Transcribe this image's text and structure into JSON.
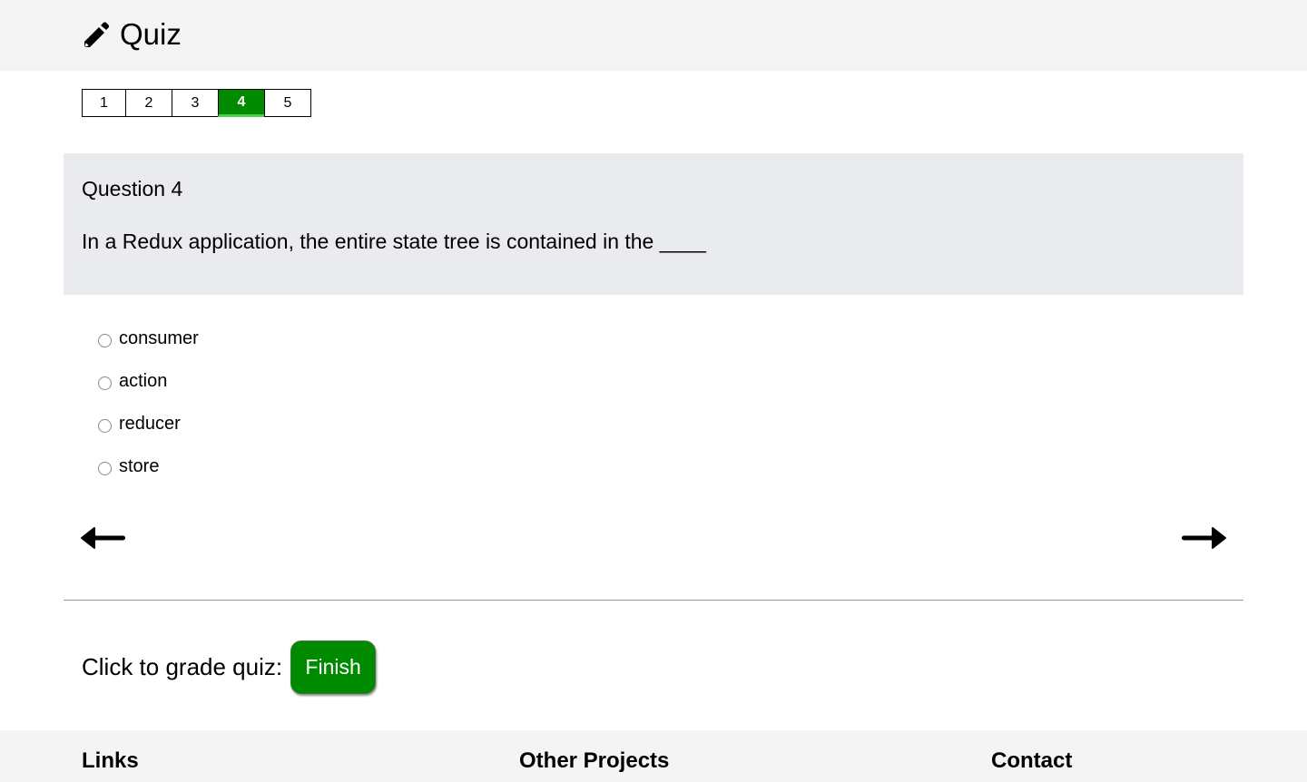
{
  "header": {
    "icon": "pencil-icon",
    "title": "Quiz"
  },
  "question_nav": {
    "items": [
      "1",
      "2",
      "3",
      "4",
      "5"
    ],
    "active": "4",
    "active_color": "#008a00"
  },
  "question": {
    "title": "Question 4",
    "text": "In a Redux application, the entire state tree is contained in the ____"
  },
  "options": [
    {
      "label": "consumer",
      "selected": false
    },
    {
      "label": "action",
      "selected": false
    },
    {
      "label": "reducer",
      "selected": false
    },
    {
      "label": "store",
      "selected": false
    }
  ],
  "navigation": {
    "prev_icon": "arrow-left-icon",
    "next_icon": "arrow-right-icon"
  },
  "grade": {
    "label": "Click to grade quiz:",
    "button_label": "Finish",
    "button_color": "#008a00"
  },
  "footer": {
    "links_title": "Links",
    "projects_title": "Other Projects",
    "contact_title": "Contact"
  }
}
